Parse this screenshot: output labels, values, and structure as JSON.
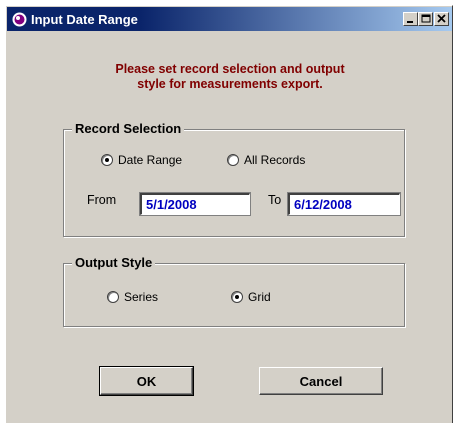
{
  "window": {
    "title": "Input Date Range",
    "icon": "cloud-app-icon",
    "controls": [
      "minimize-icon",
      "maximize-icon",
      "close-icon"
    ]
  },
  "instructions": {
    "line1": "Please set record selection and output",
    "line2": "style for measurements export."
  },
  "record_selection": {
    "legend": "Record Selection",
    "options": [
      {
        "label": "Date Range",
        "selected": true
      },
      {
        "label": "All Records",
        "selected": false
      }
    ],
    "from_label": "From",
    "from_value": "5/1/2008",
    "to_label": "To",
    "to_value": "6/12/2008"
  },
  "output_style": {
    "legend": "Output Style",
    "options": [
      {
        "label": "Series",
        "selected": false
      },
      {
        "label": "Grid",
        "selected": true
      }
    ]
  },
  "buttons": {
    "ok": "OK",
    "cancel": "Cancel"
  },
  "colors": {
    "title_bar": "#0a246a",
    "instruction_text": "#800000",
    "field_text": "#0000c0",
    "dialog_face": "#d4d0c8"
  }
}
